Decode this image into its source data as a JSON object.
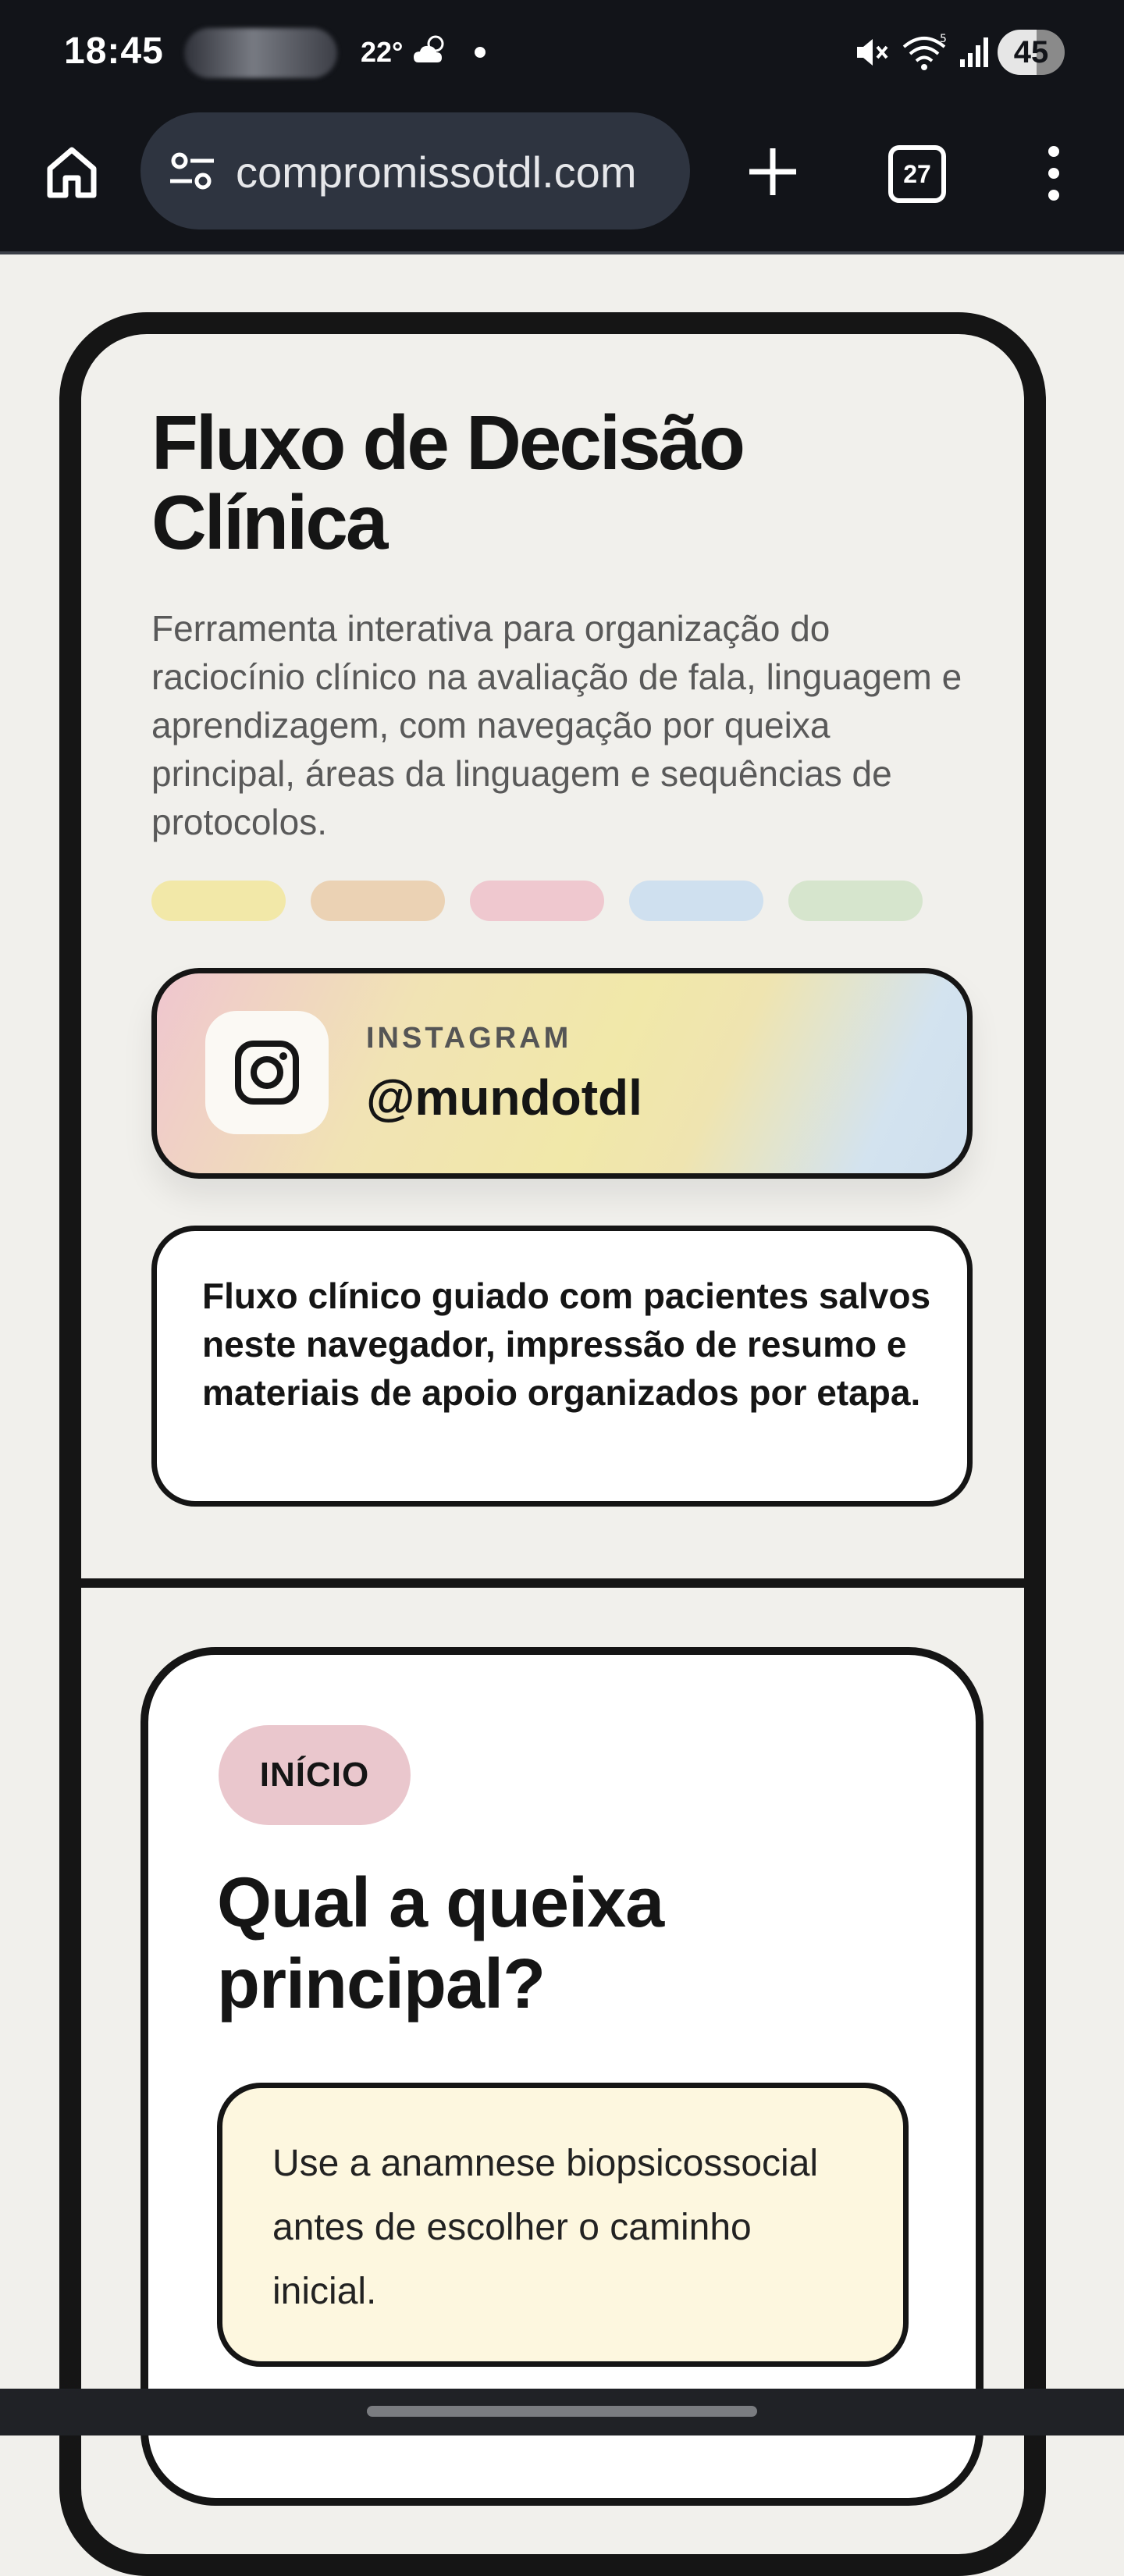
{
  "status_bar": {
    "time": "18:45",
    "temperature": "22°",
    "battery": "45"
  },
  "browser": {
    "url": "compromissotdl.com",
    "tab_count": "27"
  },
  "header": {
    "title": "Fluxo de Decisão Clínica",
    "description": "Ferramenta interativa para organização do raciocínio clínico na avaliação de fala, linguagem e aprendizagem, com navegação por queixa principal, áreas da linguagem e sequências de protocolos.",
    "pills": [
      "#f2e8a8",
      "#ebd2b4",
      "#efc8cf",
      "#cfe0ef",
      "#d6e5cd"
    ]
  },
  "instagram": {
    "label": "INSTAGRAM",
    "handle": "@mundotdl"
  },
  "info": {
    "text": "Fluxo clínico guiado com pacientes salvos neste navegador, impressão de resumo e materiais de apoio organizados por etapa."
  },
  "step": {
    "badge": "INÍCIO",
    "question": "Qual a queixa principal?",
    "hint": "Use a anamnese biopsicossocial antes de escolher o caminho inicial."
  }
}
